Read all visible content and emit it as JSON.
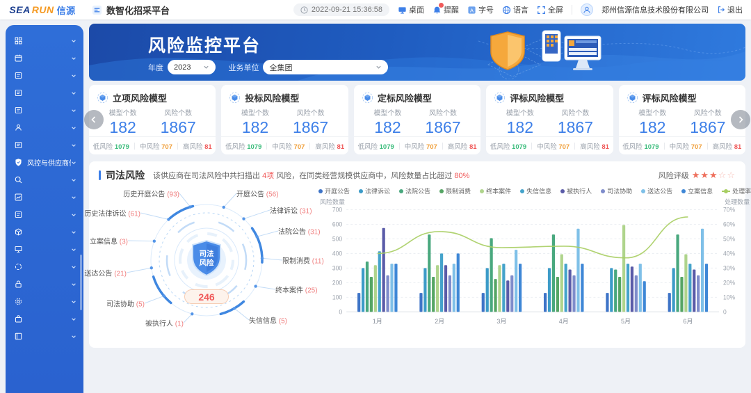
{
  "header": {
    "logo_sea": "SEA",
    "logo_run": "RUN",
    "logo_cn": "信源",
    "app_title": "数智化招采平台",
    "datetime": "2022-09-21 15:36:58",
    "actions": [
      {
        "label": "桌面",
        "icon": "desktop-icon"
      },
      {
        "label": "提醒",
        "icon": "bell-icon"
      },
      {
        "label": "字号",
        "icon": "font-size-icon"
      },
      {
        "label": "语言",
        "icon": "globe-icon"
      },
      {
        "label": "全屏",
        "icon": "fullscreen-icon"
      }
    ],
    "company": "郑州信源信息技术股份有限公司",
    "logout_label": "退出"
  },
  "sidebar": {
    "items": [
      {
        "icon": "qr-grid-icon",
        "label": ""
      },
      {
        "icon": "calendar-icon",
        "label": ""
      },
      {
        "icon": "edit-doc-icon",
        "label": ""
      },
      {
        "icon": "archive-icon",
        "label": ""
      },
      {
        "icon": "card-settings-icon",
        "label": ""
      },
      {
        "icon": "user-stamp-icon",
        "label": ""
      },
      {
        "icon": "document-icon",
        "label": ""
      },
      {
        "icon": "shield-icon",
        "label": "风控与供应商信用"
      },
      {
        "icon": "search-icon",
        "label": ""
      },
      {
        "icon": "chart-icon",
        "label": ""
      },
      {
        "icon": "briefcase-icon",
        "label": ""
      },
      {
        "icon": "cube-icon",
        "label": ""
      },
      {
        "icon": "monitor-icon",
        "label": ""
      },
      {
        "icon": "circle-icon",
        "label": ""
      },
      {
        "icon": "lock-icon",
        "label": ""
      },
      {
        "icon": "gear-icon",
        "label": ""
      },
      {
        "icon": "bag-icon",
        "label": ""
      },
      {
        "icon": "book-icon",
        "label": ""
      }
    ]
  },
  "banner": {
    "title": "风险监控平台",
    "year_label": "年度",
    "year_value": "2023",
    "unit_label": "业务单位",
    "unit_value": "全集团"
  },
  "model_cards": {
    "model_count_label": "模型个数",
    "risk_count_label": "风险个数",
    "low_label": "低风险",
    "mid_label": "中风险",
    "high_label": "高风险",
    "cards": [
      {
        "title": "立项风险模型",
        "model_count": "182",
        "risk_count": "1867",
        "low": "1079",
        "mid": "707",
        "high": "81"
      },
      {
        "title": "投标风险模型",
        "model_count": "182",
        "risk_count": "1867",
        "low": "1079",
        "mid": "707",
        "high": "81"
      },
      {
        "title": "定标风险模型",
        "model_count": "182",
        "risk_count": "1867",
        "low": "1079",
        "mid": "707",
        "high": "81"
      },
      {
        "title": "评标风险模型",
        "model_count": "182",
        "risk_count": "1867",
        "low": "1079",
        "mid": "707",
        "high": "81"
      },
      {
        "title": "评标风险模型",
        "model_count": "182",
        "risk_count": "1867",
        "low": "1079",
        "mid": "707",
        "high": "81"
      }
    ]
  },
  "judicial": {
    "section_title": "司法风险",
    "desc": {
      "p1": "该供应商在司法风险中共扫描出",
      "hl1": "4项",
      "p2": "风险，在同类经营规模供应商中，风险数量占比超过",
      "hl2": "80%"
    },
    "rating_label": "风险评级",
    "rating_filled": 3,
    "rating_total": 5,
    "center_line1": "司法",
    "center_line2": "风险",
    "total": "246",
    "radial_items": [
      {
        "label": "历史开庭公告",
        "count": "93"
      },
      {
        "label": "开庭公告",
        "count": "56"
      },
      {
        "label": "法律诉讼",
        "count": "31"
      },
      {
        "label": "法院公告",
        "count": "31"
      },
      {
        "label": "限制消费",
        "count": "11"
      },
      {
        "label": "终本案件",
        "count": "25"
      },
      {
        "label": "失信信息",
        "count": "5"
      },
      {
        "label": "被执行人",
        "count": "1"
      },
      {
        "label": "司法协助",
        "count": "5"
      },
      {
        "label": "送达公告",
        "count": "21"
      },
      {
        "label": "立案信息",
        "count": "3"
      },
      {
        "label": "历史法律诉讼",
        "count": "61"
      }
    ]
  },
  "chart_data": {
    "type": "bar",
    "title": "",
    "categories": [
      "1月",
      "2月",
      "3月",
      "4月",
      "5月",
      "6月"
    ],
    "y_left": {
      "label": "风险数量",
      "ticks": [
        0,
        100,
        200,
        300,
        400,
        500,
        600,
        700
      ],
      "max": 700
    },
    "y_right": {
      "label": "处理数量",
      "ticks": [
        "0",
        "10%",
        "20%",
        "30%",
        "40%",
        "50%",
        "60%",
        "70%"
      ],
      "max": 70
    },
    "grid": true,
    "legend_position": "top",
    "series": [
      {
        "name": "开庭公告",
        "color": "#3E74C7",
        "values": [
          130,
          130,
          130,
          130,
          130,
          130
        ]
      },
      {
        "name": "法律诉讼",
        "color": "#3C9BC8",
        "values": [
          300,
          300,
          300,
          300,
          300,
          300
        ]
      },
      {
        "name": "法院公告",
        "color": "#49A87E",
        "values": [
          345,
          530,
          505,
          530,
          290,
          530
        ]
      },
      {
        "name": "限制消费",
        "color": "#55A564",
        "values": [
          240,
          240,
          225,
          240,
          240,
          240
        ]
      },
      {
        "name": "终本案件",
        "color": "#AFD48C",
        "values": [
          320,
          320,
          320,
          395,
          595,
          395
        ]
      },
      {
        "name": "失信信息",
        "color": "#45A3CB",
        "values": [
          415,
          400,
          330,
          330,
          330,
          330
        ]
      },
      {
        "name": "被执行人",
        "color": "#5A5BA8",
        "values": [
          575,
          320,
          215,
          290,
          310,
          290
        ]
      },
      {
        "name": "司法协助",
        "color": "#7E8CCB",
        "values": [
          250,
          250,
          250,
          250,
          250,
          250
        ]
      },
      {
        "name": "送达公告",
        "color": "#7FC0E8",
        "values": [
          330,
          330,
          425,
          570,
          330,
          570
        ]
      },
      {
        "name": "立案信息",
        "color": "#3E87D6",
        "values": [
          330,
          400,
          330,
          330,
          210,
          330
        ]
      }
    ],
    "line_series": {
      "name": "处理率",
      "color": "#A8CE63",
      "values": [
        40,
        55,
        44,
        45,
        37,
        65
      ]
    }
  }
}
